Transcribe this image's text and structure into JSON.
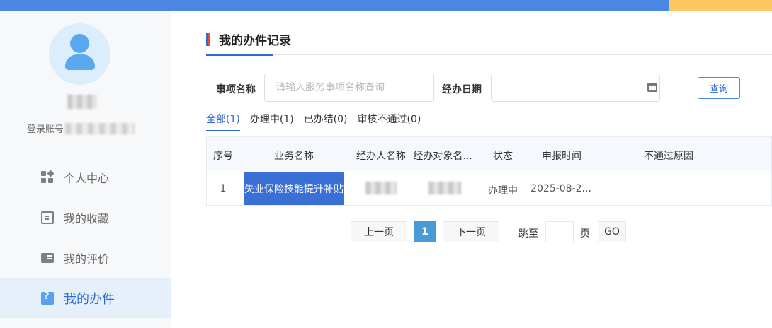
{
  "sidebar": {
    "account_label": "登录账号",
    "menu": [
      {
        "label": "个人中心",
        "icon": "grid-icon"
      },
      {
        "label": "我的收藏",
        "icon": "document-icon"
      },
      {
        "label": "我的评价",
        "icon": "id-card-icon"
      },
      {
        "label": "我的办件",
        "icon": "task-help-icon",
        "active": true
      }
    ]
  },
  "main": {
    "title": "我的办件记录",
    "filters": {
      "item_name_label": "事项名称",
      "item_name_placeholder": "请输入服务事项名称查询",
      "date_label": "经办日期",
      "query_button": "查询"
    },
    "tabs": [
      "全部(1)",
      "办理中(1)",
      "已办结(0)",
      "审核不通过(0)"
    ],
    "table": {
      "headers": [
        "序号",
        "业务名称",
        "经办人名称",
        "经办对象名...",
        "状态",
        "申报时间",
        "不通过原因"
      ],
      "rows": [
        {
          "index": "1",
          "name": "失业保险技能提升补贴",
          "status": "办理中",
          "date": "2025-08-2..."
        }
      ]
    },
    "pagination": {
      "prev": "上一页",
      "current": "1",
      "next": "下一页",
      "jump_label": "跳至",
      "page_unit": "页",
      "go": "GO"
    }
  },
  "colors": {
    "accent": "#2f6bd6",
    "topbar": "#4b88e3",
    "topbar_accent": "#fbc75e"
  }
}
